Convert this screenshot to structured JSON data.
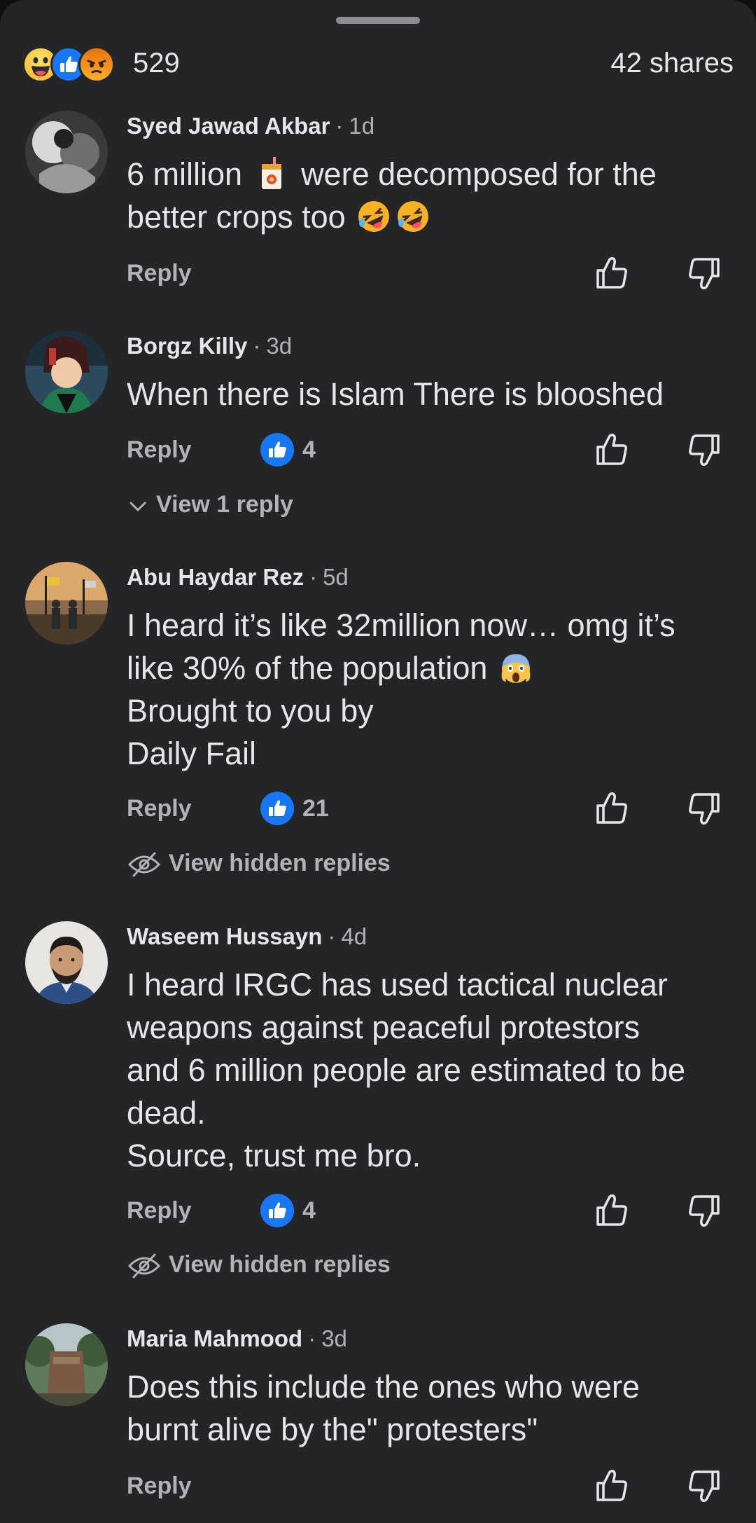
{
  "summary": {
    "reactions": [
      "haha-icon",
      "like-icon",
      "angry-icon"
    ],
    "count": "529",
    "shares": "42 shares"
  },
  "labels": {
    "reply": "Reply",
    "separator": "·"
  },
  "comments": [
    {
      "author": "Syed Jawad Akbar",
      "time": "1d",
      "lines": [
        "6 million",
        "were decomposed for the",
        "better crops too"
      ],
      "inline_emoji": [
        "juice-box-emoji",
        "rolling-laughing-emoji",
        "rolling-laughing-emoji"
      ],
      "likes": null,
      "replies_link": null
    },
    {
      "author": "Borgz Killy",
      "time": "3d",
      "lines": [
        "When there is Islam There is blooshed"
      ],
      "likes": "4",
      "replies_link": "View 1 reply"
    },
    {
      "author": "Abu Haydar Rez",
      "time": "5d",
      "lines": [
        "I heard it’s like 32million now… omg it’s",
        "like 30% of the population",
        "Brought to you by",
        "Daily Fail"
      ],
      "inline_emoji": [
        "screaming-face-emoji"
      ],
      "likes": "21",
      "replies_link": "View hidden replies"
    },
    {
      "author": "Waseem Hussayn",
      "time": "4d",
      "lines": [
        "I heard IRGC has used tactical nuclear",
        "weapons against peaceful protestors",
        "and 6 million people are estimated to be",
        "dead.",
        "Source, trust me bro."
      ],
      "likes": "4",
      "replies_link": "View hidden replies"
    },
    {
      "author": "Maria Mahmood",
      "time": "3d",
      "lines": [
        "Does this include the ones who were",
        "burnt alive by the\" protesters\""
      ],
      "likes": null,
      "replies_link": null
    }
  ],
  "colors": {
    "background": "#242526",
    "text_primary": "#e4e6eb",
    "text_secondary": "#b0b3b8",
    "like_blue": "#1877f2"
  }
}
